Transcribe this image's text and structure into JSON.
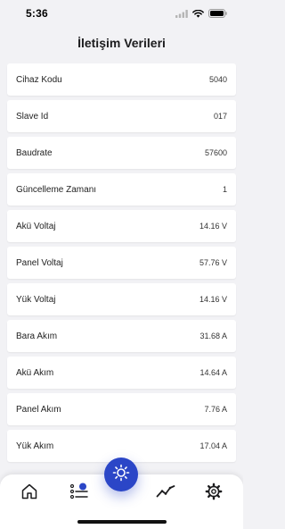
{
  "status_bar": {
    "time": "5:36"
  },
  "header": {
    "title": "İletişim Verileri"
  },
  "rows": [
    {
      "label": "Cihaz Kodu",
      "value": "5040"
    },
    {
      "label": "Slave Id",
      "value": "017"
    },
    {
      "label": "Baudrate",
      "value": "57600"
    },
    {
      "label": "Güncelleme Zamanı",
      "value": "1"
    },
    {
      "label": "Akü Voltaj",
      "value": "14.16 V"
    },
    {
      "label": "Panel Voltaj",
      "value": "57.76 V"
    },
    {
      "label": "Yük Voltaj",
      "value": "14.16 V"
    },
    {
      "label": "Bara Akım",
      "value": "31.68 A"
    },
    {
      "label": "Akü Akım",
      "value": "14.64 A"
    },
    {
      "label": "Panel Akım",
      "value": "7.76 A"
    },
    {
      "label": "Yük Akım",
      "value": "17.04 A"
    }
  ],
  "bottom_nav": {
    "items": [
      {
        "icon": "home-icon"
      },
      {
        "icon": "list-icon"
      },
      {
        "icon": "sun-icon",
        "active": true
      },
      {
        "icon": "trend-chart-icon"
      },
      {
        "icon": "gear-icon"
      }
    ]
  },
  "colors": {
    "accent": "#2b46c7",
    "background": "#f2f2f5",
    "card": "#ffffff"
  }
}
